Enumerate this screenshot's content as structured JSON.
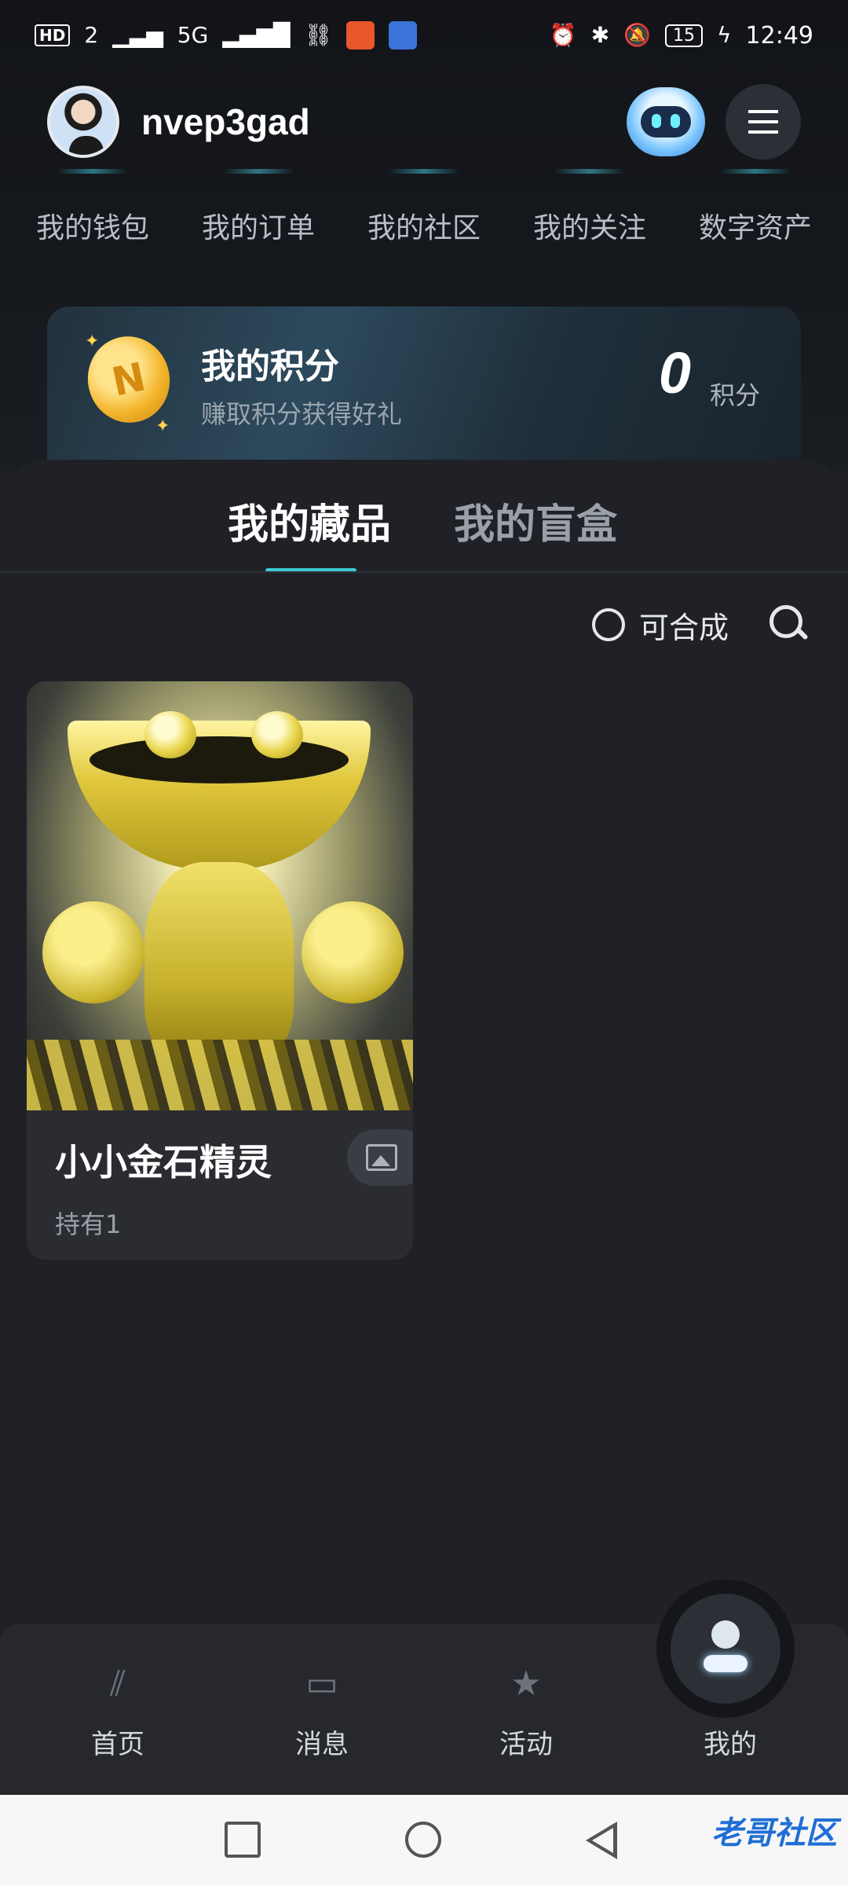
{
  "status_bar": {
    "network_badges": [
      "HD",
      "2",
      "5G"
    ],
    "time": "12:49",
    "battery": "15"
  },
  "header": {
    "username": "nvep3gad"
  },
  "quick_nav": [
    {
      "label": "我的钱包"
    },
    {
      "label": "我的订单"
    },
    {
      "label": "我的社区"
    },
    {
      "label": "我的关注"
    },
    {
      "label": "数字资产"
    }
  ],
  "points_card": {
    "title": "我的积分",
    "subtitle": "赚取积分获得好礼",
    "value": "0",
    "unit": "积分"
  },
  "tabs": [
    {
      "label": "我的藏品",
      "active": true
    },
    {
      "label": "我的盲盒",
      "active": false
    }
  ],
  "filters": {
    "composable_label": "可合成"
  },
  "collection": [
    {
      "name": "小小金石精灵",
      "holding": "持有1"
    }
  ],
  "bottom_nav": [
    {
      "label": "首页",
      "icon": "home-icon"
    },
    {
      "label": "消息",
      "icon": "message-icon"
    },
    {
      "label": "活动",
      "icon": "activity-icon"
    },
    {
      "label": "我的",
      "icon": "profile-icon",
      "active": true
    }
  ],
  "watermark": "老哥社区",
  "colors": {
    "accent": "#3ec7d2",
    "background": "#1f2126",
    "card": "#2a2c31"
  }
}
